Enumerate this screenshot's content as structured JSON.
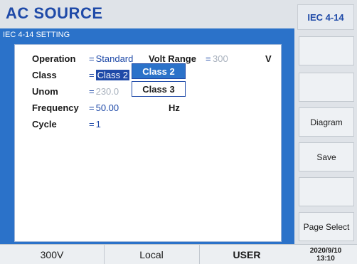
{
  "header": {
    "title": "AC SOURCE",
    "standard": "IEC 4-14"
  },
  "content": {
    "title": "IEC 4-14 SETTING",
    "fields": {
      "operation": {
        "label": "Operation",
        "eq": "=",
        "value": "Standard"
      },
      "volt_range": {
        "label": "Volt Range",
        "eq": "=",
        "value": "300",
        "unit": "V"
      },
      "class": {
        "label": "Class",
        "eq": "=",
        "value": "Class 2"
      },
      "unom": {
        "label": "Unom",
        "eq": "=",
        "value": "230.0"
      },
      "frequency": {
        "label": "Frequency",
        "eq": "=",
        "value": "50.00",
        "unit": "Hz"
      },
      "cycle": {
        "label": "Cycle",
        "eq": "=",
        "value": "1"
      }
    },
    "dropdown": {
      "options": [
        "Class 2",
        "Class 3"
      ],
      "selected": "Class 2"
    }
  },
  "right_panel": {
    "buttons": [
      "",
      "",
      "Diagram",
      "Save",
      "",
      "Page Select"
    ]
  },
  "status_bar": {
    "range": "300V",
    "mode": "Local",
    "user": "USER",
    "date": "2020/9/10",
    "time": "13:10"
  },
  "colors": {
    "accent": "#1f4aa8",
    "panel_bg": "#2b72c9",
    "disabled": "#a8b1bd"
  }
}
